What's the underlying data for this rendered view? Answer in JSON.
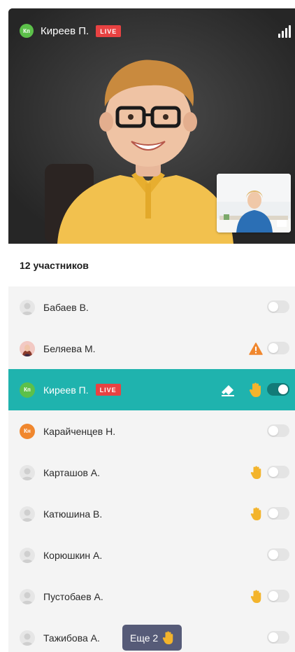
{
  "video": {
    "speaker_initials": "Кп",
    "speaker_name": "Киреев П.",
    "live_badge": "LIVE",
    "signal_icon": "signal-strength-icon",
    "colors": {
      "initials_bg": "#5cc04a",
      "live_bg": "#e84242"
    }
  },
  "participants": {
    "count_label": "12 участников",
    "rows": [
      {
        "name": "Бабаев В.",
        "avatar": "placeholder-avatar-icon",
        "toggle_on": false
      },
      {
        "name": "Беляева М.",
        "avatar": "photo-avatar",
        "warning": true,
        "toggle_on": false
      },
      {
        "name": "Киреев П.",
        "initials": "Кп",
        "live": "LIVE",
        "eraser": true,
        "hand": true,
        "toggle_on": true,
        "active": true
      },
      {
        "name": "Карайченцев Н.",
        "initials": "Кн",
        "toggle_on": false
      },
      {
        "name": "Карташов А.",
        "avatar": "placeholder-avatar-icon",
        "hand": true,
        "toggle_on": false
      },
      {
        "name": "Катюшина В.",
        "avatar": "placeholder-avatar-icon",
        "hand": true,
        "toggle_on": false
      },
      {
        "name": "Корюшкин А.",
        "avatar": "placeholder-avatar-icon",
        "toggle_on": false
      },
      {
        "name": "Пустобаев А.",
        "avatar": "placeholder-avatar-icon",
        "hand": true,
        "toggle_on": false
      },
      {
        "name": "Тажибова А.",
        "avatar": "placeholder-avatar-icon",
        "toggle_on": false
      }
    ],
    "more_label": "Еще 2",
    "colors": {
      "active_row": "#1fb3ae",
      "toggle_on": "#127b78",
      "orange": "#f0872e",
      "hand": "#f3b42c"
    }
  }
}
